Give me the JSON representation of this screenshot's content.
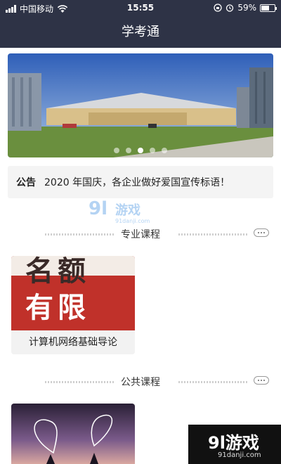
{
  "status_bar": {
    "carrier": "中国移动",
    "time": "15:55",
    "battery": "59%",
    "battery_level": 0.59
  },
  "app": {
    "title": "学考通"
  },
  "banner": {
    "slide_count": 5,
    "active_index": 2
  },
  "notice": {
    "tag": "公告",
    "text": "2020 年国庆，各企业做好爱国宣传标语！"
  },
  "sections": {
    "professional": {
      "title": "专业课程",
      "courses": [
        {
          "cover_text_1": "名额",
          "cover_text_2": "有限",
          "label": "计算机网络基础导论"
        }
      ]
    },
    "public": {
      "title": "公共课程"
    }
  },
  "watermark": {
    "logo_top": "9l游戏",
    "site_top": "91danji.com",
    "logo_corner": "9l游戏",
    "site_corner": "91danji.com"
  },
  "colors": {
    "navbar": "#2e3346",
    "cover_red": "#c0312a"
  }
}
